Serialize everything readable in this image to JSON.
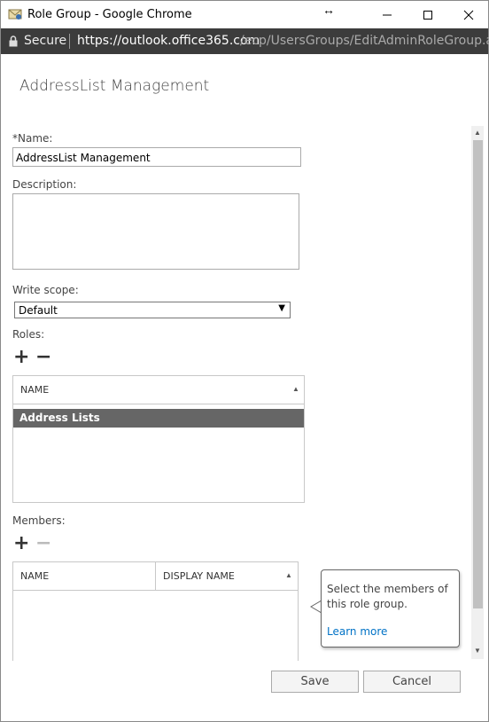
{
  "window": {
    "title": "Role Group - Google Chrome",
    "security_label": "Secure",
    "url_host": "https://outlook.office365.com",
    "url_path": "/ecp/UsersGroups/EditAdminRoleGroup.as..."
  },
  "page": {
    "title": "AddressList Management"
  },
  "form": {
    "name_label": "*Name:",
    "name_value": "AddressList Management",
    "description_label": "Description:",
    "description_value": "",
    "write_scope_label": "Write scope:",
    "write_scope_value": "Default",
    "roles_label": "Roles:",
    "roles_add": "+",
    "roles_remove": "−",
    "members_label": "Members:",
    "members_add": "+",
    "members_remove": "−"
  },
  "roles_grid": {
    "columns": [
      "NAME"
    ],
    "rows": [
      "Address Lists"
    ]
  },
  "members_grid": {
    "columns": [
      "NAME",
      "DISPLAY NAME"
    ],
    "rows": []
  },
  "callout": {
    "text": "Select the members of this role group.",
    "link": "Learn more"
  },
  "buttons": {
    "save": "Save",
    "cancel": "Cancel"
  },
  "colors": {
    "selected_row": "#666666",
    "link": "#0072c6",
    "address_bar": "#3c3c3c"
  }
}
